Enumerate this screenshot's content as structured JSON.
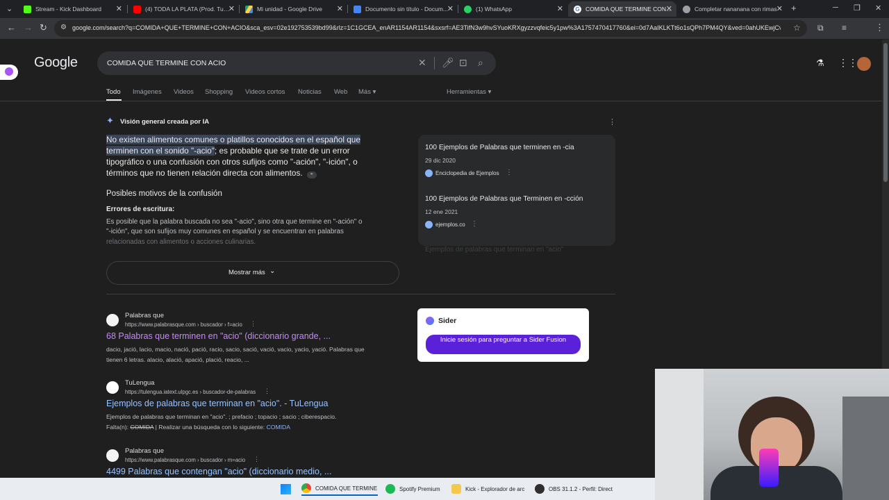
{
  "browser": {
    "tabs": [
      {
        "label": "Stream - Kick Dashboard",
        "color": "#53fc18"
      },
      {
        "label": "(4) TODA LA PLATA (Prod. Tum...",
        "color": "#ff0000"
      },
      {
        "label": "Mi unidad - Google Drive",
        "color": "#1fa463"
      },
      {
        "label": "Documento sin título - Docum...",
        "color": "#4285f4"
      },
      {
        "label": "(1) WhatsApp",
        "color": "#25d366"
      },
      {
        "label": "COMIDA QUE TERMINE CON A...",
        "color": "#4285f4"
      },
      {
        "label": "Completar nananana con rimas",
        "color": "#9aa0a6"
      }
    ],
    "new_tab": "+",
    "url": "google.com/search?q=COMIDA+QUE+TERMINE+CON+ACIO&sca_esv=02e192753539bd99&rlz=1C1GCEA_enAR1154AR1154&sxsrf=AE3TifN3w9hvSYuoKRXgyzzvqfeic5y1pw%3A1757470417760&ei=0d7AaIKLKTt6o1sQPh7PM4QY&ved=0ahUKEwjCv..."
  },
  "google": {
    "logo": "Google",
    "query": "COMIDA QUE TERMINE CON ACIO",
    "tabs": [
      "Todo",
      "Imágenes",
      "Videos",
      "Shopping",
      "Videos cortos",
      "Noticias",
      "Web",
      "Más ▾"
    ],
    "tools": "Herramientas ▾"
  },
  "ai_overview": {
    "header": "Visión general creada por IA",
    "lead_hl_1": "No existen alimentos comunes o platillos conocidos en el español que",
    "lead_hl_2": "terminen con el sonido \"-acio\"",
    "lead_rest_2": "; es probable que se trate de un error",
    "lead_3": "tipográfico o una confusión con otros sufijos como \"-ación\", \"-ición\", o",
    "lead_4": "términos que no tienen relación directa con alimentos.",
    "section_title": "Posibles motivos de la confusión",
    "sub_title": "Errores de escritura:",
    "body_1": "Es posible que la palabra buscada no sea \"-acio\", sino otra que termine en \"-ación\" o",
    "body_2": "\"-ición\", que son sufijos muy comunes en español y se encuentran en palabras",
    "body_3": "relacionadas con alimentos o acciones culinarias.",
    "more_button": "Mostrar más",
    "sources": [
      {
        "title": "100 Ejemplos de Palabras que terminen en -cia",
        "date": "29 dic 2020",
        "site": "Enciclopedia de Ejemplos"
      },
      {
        "title": "100 Ejemplos de Palabras que Terminen en -cción",
        "date": "12 ene 2021",
        "site": "ejemplos.co"
      }
    ],
    "faded_source": "Ejemplos de palabras que terminan en \"acio\""
  },
  "results": [
    {
      "site": "Palabras que",
      "url": "https://www.palabrasque.com › buscador › f=acio",
      "title": "68 Palabras que terminen en \"acio\" (diccionario grande, ...",
      "snippet_1": "dacio, jació, lacio, macio, nació, pació, racio, sacio, sació, vació, vacio, yacio, yació. Palabras que",
      "snippet_2": "tienen 6 letras. alacio, alació, apació, plació, reacio, ..."
    },
    {
      "site": "TuLengua",
      "url": "https://tulengua.iatext.ulpgc.es › buscador-de-palabras",
      "title": "Ejemplos de palabras que terminan en \"acio\". - TuLengua",
      "snippet_1": "Ejemplos de palabras que terminan en \"acio\". ; prefacio ; topacio ; sacio ; ciberespacio.",
      "snippet_2_prefix": "Falta(n): ",
      "snippet_2_strike": "COMIDA",
      "snippet_2_mid": " | Realizar una búsqueda con lo siguiente: ",
      "snippet_2_link": "COMIDA"
    },
    {
      "site": "Palabras que",
      "url": "https://www.palabrasque.com › buscador › m=acio",
      "title": "4499 Palabras que contengan \"acio\" (diccionario medio, ..."
    }
  ],
  "sider": {
    "name": "Sider",
    "button": "Inicie sesión para preguntar a Sider Fusion"
  },
  "taskbar": {
    "apps": [
      {
        "label": "COMIDA QUE TERMINE",
        "color": "#4285f4"
      },
      {
        "label": "Spotify Premium",
        "color": "#1db954"
      },
      {
        "label": "Kick - Explorador de arc",
        "color": "#f2c94c"
      },
      {
        "label": "OBS 31.1.2 - Perfil: Direct",
        "color": "#302e31"
      }
    ]
  }
}
